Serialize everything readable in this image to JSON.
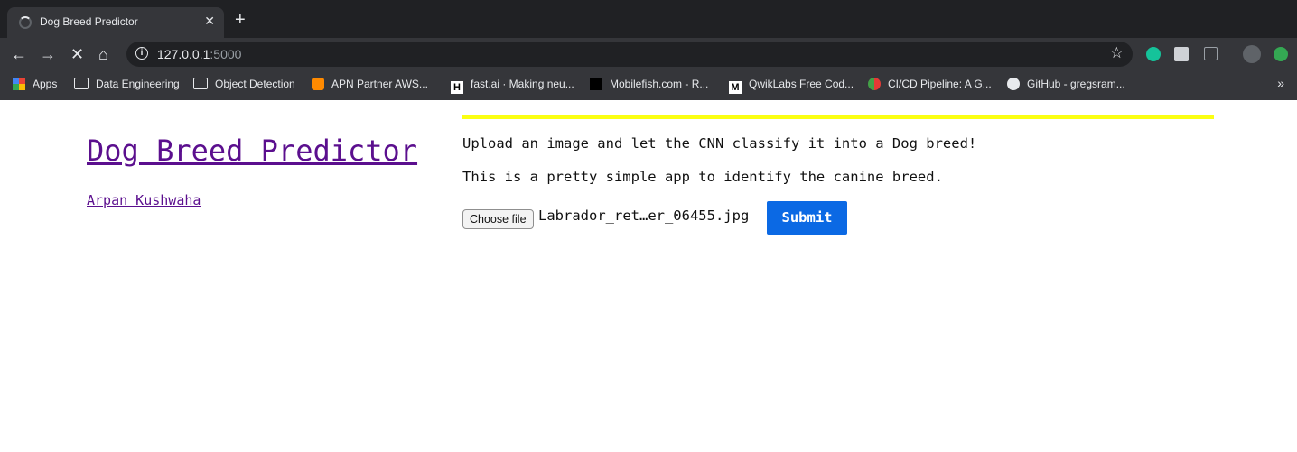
{
  "browser": {
    "tab_title": "Dog Breed Predictor",
    "url_host": "127.0.0.1",
    "url_port": ":5000",
    "bookmarks": [
      {
        "label": "Apps",
        "icon": "apps-grid-icon"
      },
      {
        "label": "Data Engineering",
        "icon": "folder-icon"
      },
      {
        "label": "Object Detection",
        "icon": "folder-icon"
      },
      {
        "label": "APN Partner AWS...",
        "icon": "aws-icon"
      },
      {
        "label": "fast.ai · Making neu...",
        "icon": "hackernews-icon"
      },
      {
        "label": "Mobilefish.com - R...",
        "icon": "mobilefish-icon"
      },
      {
        "label": "QwikLabs Free Cod...",
        "icon": "medium-icon"
      },
      {
        "label": "CI/CD Pipeline: A G...",
        "icon": "pipeline-icon"
      },
      {
        "label": "GitHub - gregsram...",
        "icon": "github-icon"
      }
    ]
  },
  "page": {
    "title": "Dog Breed Predictor",
    "author": "Arpan Kushwaha",
    "lead": "Upload an image and let the CNN classify it into a Dog breed!",
    "description": "This is a pretty simple app to identify the canine breed.",
    "choose_file_label": "Choose file",
    "file_name": "Labrador_ret…er_06455.jpg",
    "submit_label": "Submit"
  },
  "colors": {
    "accent_bar": "#fbff12",
    "submit_button": "#0b69e4",
    "visited_link": "#5b0f8e"
  }
}
